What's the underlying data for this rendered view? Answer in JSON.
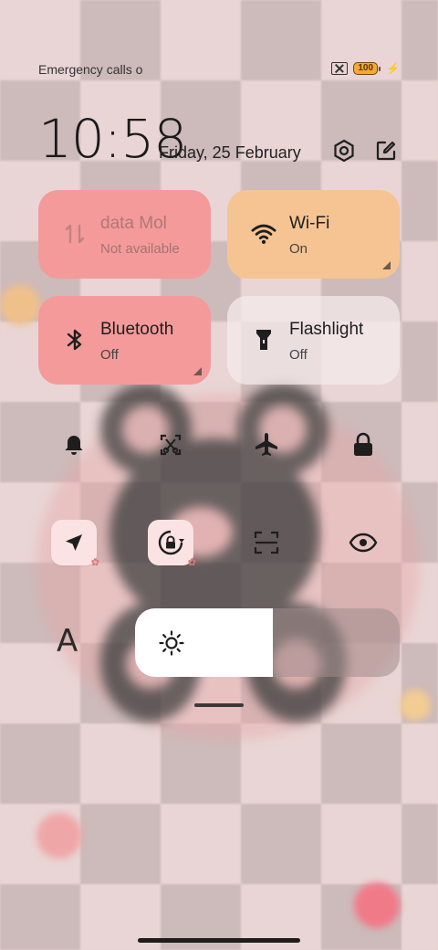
{
  "status_bar": {
    "carrier_text": "Emergency calls o",
    "battery_level": "100",
    "icons": [
      "no-sim-icon",
      "battery-icon",
      "charging-bolt-icon"
    ]
  },
  "header": {
    "time": "10:58",
    "date": "Friday, 25 February",
    "icons": [
      "settings-icon",
      "edit-icon"
    ]
  },
  "tiles": [
    {
      "title": "Mobile data",
      "title_visible": "data    Mol",
      "subtitle": "Not available",
      "icon": "mobile-data-icon",
      "state": "disabled",
      "color": "#f49a9a"
    },
    {
      "title": "Wi-Fi",
      "subtitle": "On",
      "icon": "wifi-icon",
      "state": "on",
      "color": "#f6c493"
    },
    {
      "title": "Bluetooth",
      "subtitle": "Off",
      "icon": "bluetooth-icon",
      "state": "off",
      "color": "#f49a9a"
    },
    {
      "title": "Flashlight",
      "subtitle": "Off",
      "icon": "flashlight-icon",
      "state": "off",
      "color": "#f3e9e9"
    }
  ],
  "toggle_row_1": [
    {
      "icon": "bell-icon",
      "active": false
    },
    {
      "icon": "screenshot-icon",
      "active": false
    },
    {
      "icon": "airplane-icon",
      "active": false
    },
    {
      "icon": "lock-icon",
      "active": false
    }
  ],
  "toggle_row_2": [
    {
      "icon": "location-icon",
      "active": true
    },
    {
      "icon": "rotation-lock-icon",
      "active": true
    },
    {
      "icon": "scanner-icon",
      "active": false
    },
    {
      "icon": "eye-icon",
      "active": false
    }
  ],
  "brightness": {
    "label_icon": "text-size-icon",
    "label_text": "A",
    "level_fraction": 0.52
  },
  "colors": {
    "tile_red": "#f49a9a",
    "tile_orange": "#f6c493",
    "active_toggle_bg": "#fbe3e3"
  }
}
